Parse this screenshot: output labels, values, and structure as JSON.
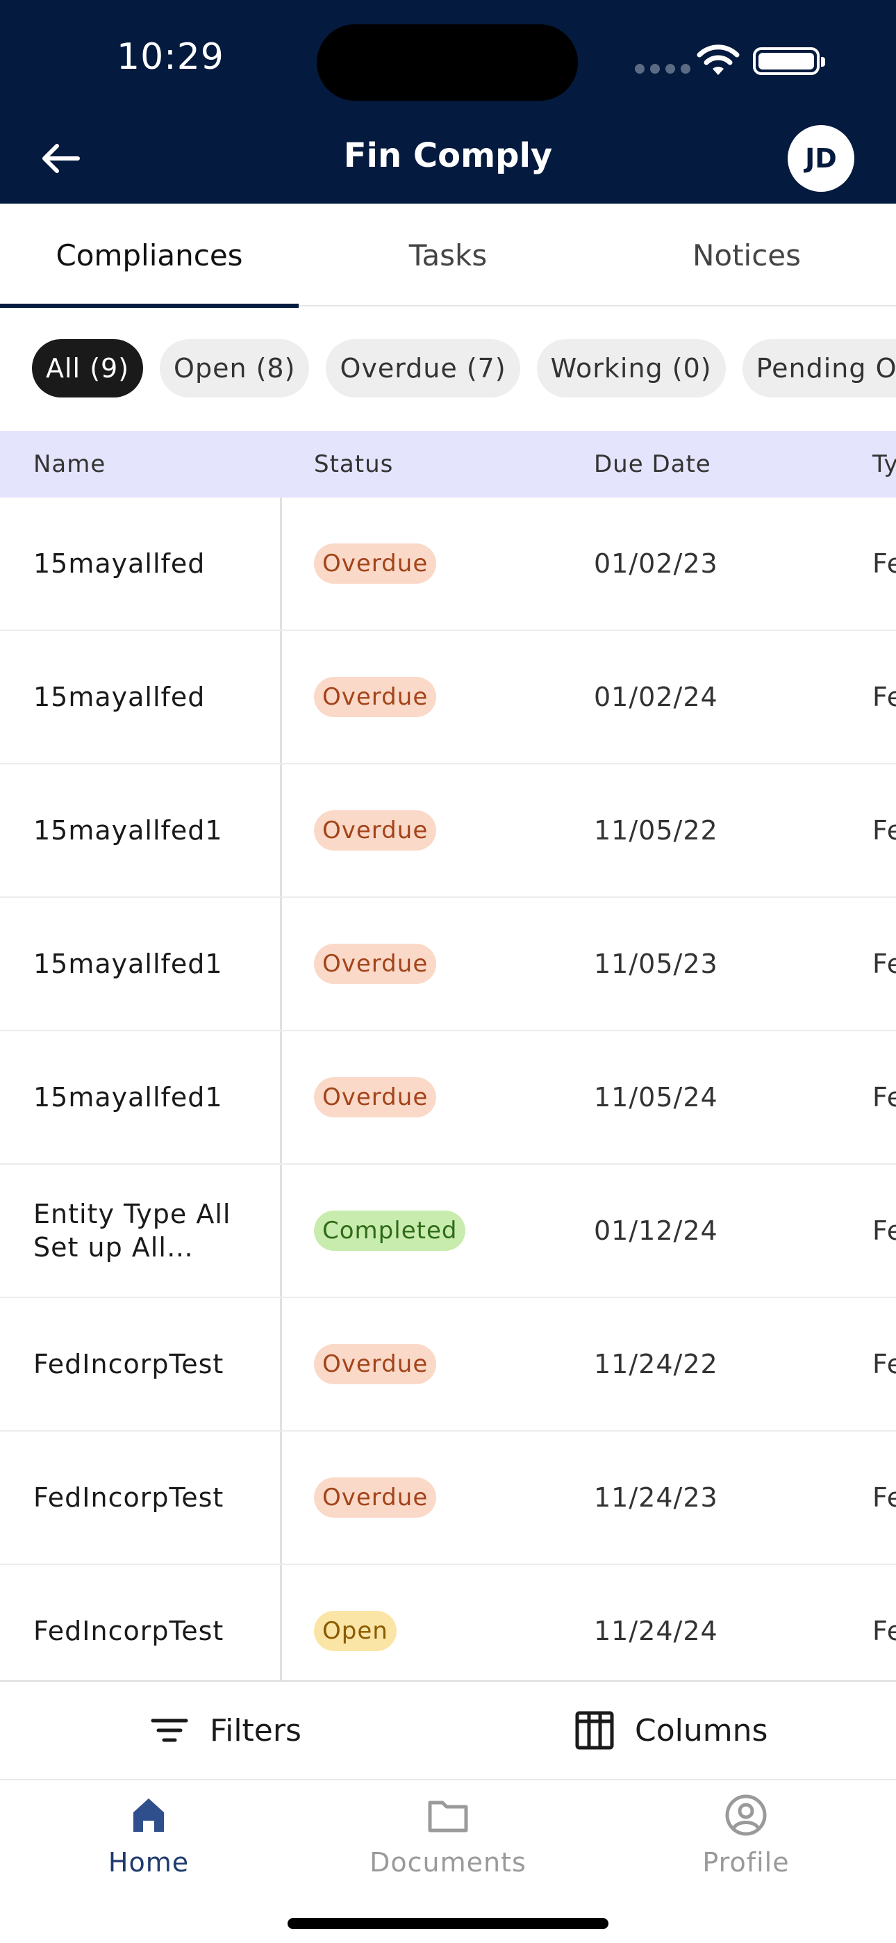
{
  "status_bar": {
    "time": "10:29"
  },
  "header": {
    "title": "Fin Comply",
    "avatar_initials": "JD"
  },
  "tabs": [
    {
      "label": "Compliances",
      "active": true
    },
    {
      "label": "Tasks",
      "active": false
    },
    {
      "label": "Notices",
      "active": false
    }
  ],
  "chips": [
    {
      "label": "All (9)",
      "active": true
    },
    {
      "label": "Open (8)",
      "active": false
    },
    {
      "label": "Overdue (7)",
      "active": false
    },
    {
      "label": "Working (0)",
      "active": false
    },
    {
      "label": "Pending On",
      "active": false
    }
  ],
  "table": {
    "columns": [
      "Name",
      "Status",
      "Due Date",
      "Ty"
    ],
    "rows": [
      {
        "name": "15mayallfed",
        "status": "Overdue",
        "due": "01/02/23",
        "type": "Fe"
      },
      {
        "name": "15mayallfed",
        "status": "Overdue",
        "due": "01/02/24",
        "type": "Fe"
      },
      {
        "name": "15mayallfed1",
        "status": "Overdue",
        "due": "11/05/22",
        "type": "Fe"
      },
      {
        "name": "15mayallfed1",
        "status": "Overdue",
        "due": "11/05/23",
        "type": "Fe"
      },
      {
        "name": "15mayallfed1",
        "status": "Overdue",
        "due": "11/05/24",
        "type": "Fe"
      },
      {
        "name": "Entity Type All Set up All comp…",
        "status": "Completed",
        "due": "01/12/24",
        "type": "Fe"
      },
      {
        "name": "FedIncorpTest",
        "status": "Overdue",
        "due": "11/24/22",
        "type": "Fe"
      },
      {
        "name": "FedIncorpTest",
        "status": "Overdue",
        "due": "11/24/23",
        "type": "Fe"
      },
      {
        "name": "FedIncorpTest",
        "status": "Open",
        "due": "11/24/24",
        "type": "Fe"
      }
    ]
  },
  "toolbar": {
    "filters_label": "Filters",
    "columns_label": "Columns"
  },
  "bottom_nav": [
    {
      "label": "Home",
      "icon": "home-icon",
      "active": true
    },
    {
      "label": "Documents",
      "icon": "folder-icon",
      "active": false
    },
    {
      "label": "Profile",
      "icon": "profile-icon",
      "active": false
    }
  ],
  "colors": {
    "header_bg": "#041a3e",
    "table_header_bg": "#e4e4fc",
    "overdue_bg": "#fbd9c8",
    "completed_bg": "#c8ecae",
    "open_bg": "#fbe5a6",
    "active_nav": "#1f3a6e"
  }
}
